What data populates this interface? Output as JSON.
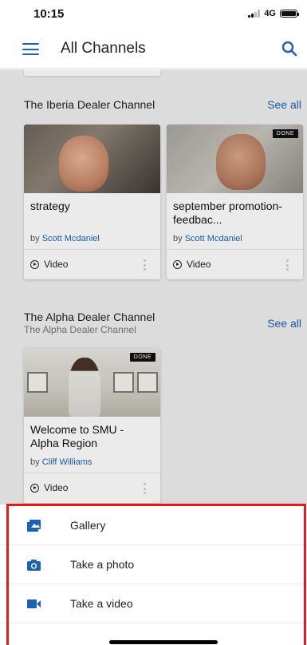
{
  "status_bar": {
    "time": "10:15",
    "network": "4G"
  },
  "app_bar": {
    "title": "All Channels",
    "menu_icon": "hamburger-menu-icon",
    "search_icon": "search-icon"
  },
  "sections": [
    {
      "title": "The Iberia Dealer Channel",
      "see_all": "See all",
      "cards": [
        {
          "title": "strategy",
          "by": "by",
          "author": "Scott Mcdaniel",
          "type": "Video",
          "badge": ""
        },
        {
          "title": "september promotion- feedbac...",
          "by": "by",
          "author": "Scott Mcdaniel",
          "type": "Video",
          "badge": "DONE"
        }
      ]
    },
    {
      "title": "The Alpha Dealer Channel",
      "subtitle": "The Alpha Dealer Channel",
      "see_all": "See all",
      "cards": [
        {
          "title": "Welcome to SMU - Alpha Region",
          "by": "by",
          "author": "Cliff Williams",
          "type": "Video",
          "badge": "DONE"
        }
      ]
    }
  ],
  "bottom_sheet": {
    "items": [
      {
        "label": "Gallery",
        "icon": "gallery-icon"
      },
      {
        "label": "Take a photo",
        "icon": "camera-icon"
      },
      {
        "label": "Take a video",
        "icon": "video-camera-icon"
      }
    ]
  },
  "colors": {
    "accent": "#1e62b5",
    "highlight": "#e31b1b"
  }
}
